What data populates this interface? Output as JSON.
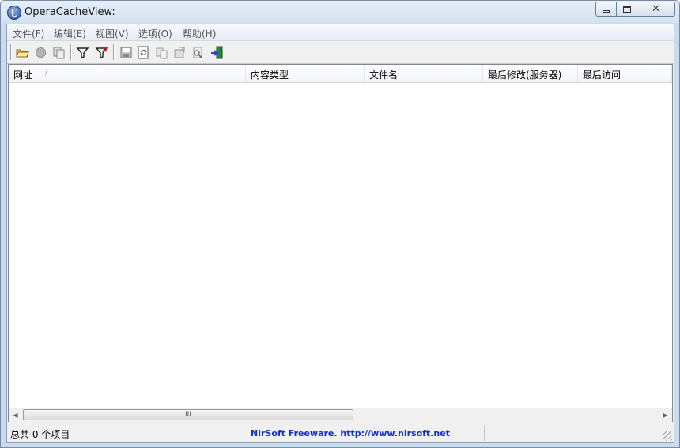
{
  "window": {
    "title": "OperaCacheView:",
    "app_icon": "opera-icon",
    "controls": {
      "minimize_icon": "minimize-icon",
      "maximize_icon": "maximize-icon",
      "close_icon": "close-icon",
      "close_glyph": "✕"
    }
  },
  "menu": {
    "items": [
      {
        "label": "文件(F)"
      },
      {
        "label": "编辑(E)"
      },
      {
        "label": "视图(V)"
      },
      {
        "label": "选项(O)"
      },
      {
        "label": "帮助(H)"
      }
    ]
  },
  "toolbar": {
    "buttons": [
      {
        "icon": "open-folder-icon"
      },
      {
        "icon": "stop-icon"
      },
      {
        "icon": "copy-files-icon"
      },
      {
        "icon": "filter-icon"
      },
      {
        "icon": "filter-remove-icon"
      },
      {
        "icon": "save-icon"
      },
      {
        "icon": "refresh-icon"
      },
      {
        "icon": "copy-icon"
      },
      {
        "icon": "properties-icon"
      },
      {
        "icon": "find-icon"
      },
      {
        "icon": "exit-icon"
      }
    ]
  },
  "list": {
    "columns": [
      {
        "label": "网址"
      },
      {
        "label": "内容类型"
      },
      {
        "label": "文件名"
      },
      {
        "label": "最后修改(服务器)"
      },
      {
        "label": "最后访问"
      }
    ],
    "sort_indicator": "/",
    "rows": []
  },
  "scrollbar": {
    "left_arrow": "◀",
    "right_arrow": "▶",
    "grip": "III"
  },
  "status": {
    "count_text": "总共 0 个项目",
    "link_text": "NirSoft Freeware.  http://www.nirsoft.net"
  },
  "colors": {
    "link": "#1530c8",
    "title_bar": "#d3e1f1"
  }
}
